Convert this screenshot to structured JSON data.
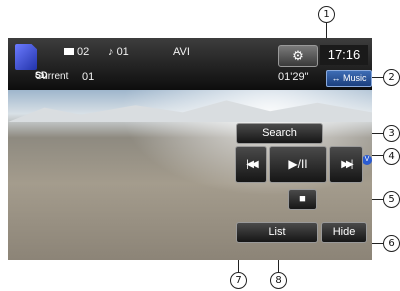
{
  "header": {
    "folder_number": "02",
    "track_icon": "♪",
    "track_number": "01",
    "file_format": "AVI",
    "current_label": "Current",
    "current_value": "01",
    "elapsed_time": "01'29\"",
    "clock": "17:16",
    "source_icon": "sd-card-icon",
    "source_label": "SD",
    "music_button": "↔ Music",
    "settings_icon": "⚙"
  },
  "controls": {
    "search": "Search",
    "prev": "◀◀",
    "prev_bar": "|",
    "play_pause": "▶/II",
    "next": "▶▶",
    "next_bar": "|",
    "stop": "■",
    "list": "List",
    "hide": "Hide"
  },
  "badge": "V",
  "callouts": [
    "1",
    "2",
    "3",
    "4",
    "5",
    "6",
    "7",
    "8"
  ]
}
